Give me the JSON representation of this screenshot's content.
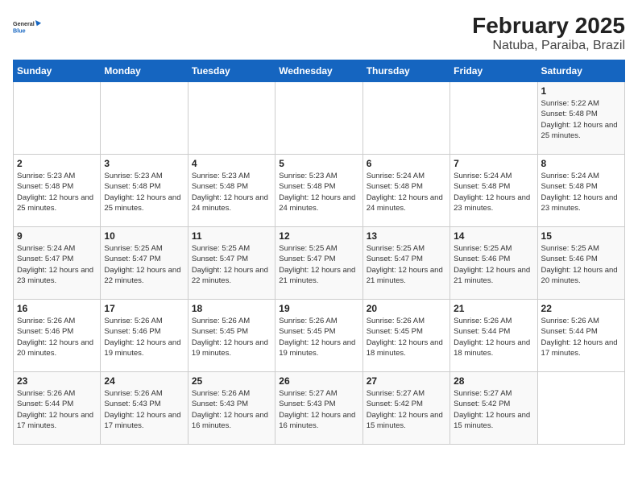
{
  "logo": {
    "text_general": "General",
    "text_blue": "Blue"
  },
  "title": "February 2025",
  "subtitle": "Natuba, Paraiba, Brazil",
  "days_of_week": [
    "Sunday",
    "Monday",
    "Tuesday",
    "Wednesday",
    "Thursday",
    "Friday",
    "Saturday"
  ],
  "weeks": [
    [
      {
        "day": "",
        "info": ""
      },
      {
        "day": "",
        "info": ""
      },
      {
        "day": "",
        "info": ""
      },
      {
        "day": "",
        "info": ""
      },
      {
        "day": "",
        "info": ""
      },
      {
        "day": "",
        "info": ""
      },
      {
        "day": "1",
        "info": "Sunrise: 5:22 AM\nSunset: 5:48 PM\nDaylight: 12 hours and 25 minutes."
      }
    ],
    [
      {
        "day": "2",
        "info": "Sunrise: 5:23 AM\nSunset: 5:48 PM\nDaylight: 12 hours and 25 minutes."
      },
      {
        "day": "3",
        "info": "Sunrise: 5:23 AM\nSunset: 5:48 PM\nDaylight: 12 hours and 25 minutes."
      },
      {
        "day": "4",
        "info": "Sunrise: 5:23 AM\nSunset: 5:48 PM\nDaylight: 12 hours and 24 minutes."
      },
      {
        "day": "5",
        "info": "Sunrise: 5:23 AM\nSunset: 5:48 PM\nDaylight: 12 hours and 24 minutes."
      },
      {
        "day": "6",
        "info": "Sunrise: 5:24 AM\nSunset: 5:48 PM\nDaylight: 12 hours and 24 minutes."
      },
      {
        "day": "7",
        "info": "Sunrise: 5:24 AM\nSunset: 5:48 PM\nDaylight: 12 hours and 23 minutes."
      },
      {
        "day": "8",
        "info": "Sunrise: 5:24 AM\nSunset: 5:48 PM\nDaylight: 12 hours and 23 minutes."
      }
    ],
    [
      {
        "day": "9",
        "info": "Sunrise: 5:24 AM\nSunset: 5:47 PM\nDaylight: 12 hours and 23 minutes."
      },
      {
        "day": "10",
        "info": "Sunrise: 5:25 AM\nSunset: 5:47 PM\nDaylight: 12 hours and 22 minutes."
      },
      {
        "day": "11",
        "info": "Sunrise: 5:25 AM\nSunset: 5:47 PM\nDaylight: 12 hours and 22 minutes."
      },
      {
        "day": "12",
        "info": "Sunrise: 5:25 AM\nSunset: 5:47 PM\nDaylight: 12 hours and 21 minutes."
      },
      {
        "day": "13",
        "info": "Sunrise: 5:25 AM\nSunset: 5:47 PM\nDaylight: 12 hours and 21 minutes."
      },
      {
        "day": "14",
        "info": "Sunrise: 5:25 AM\nSunset: 5:46 PM\nDaylight: 12 hours and 21 minutes."
      },
      {
        "day": "15",
        "info": "Sunrise: 5:25 AM\nSunset: 5:46 PM\nDaylight: 12 hours and 20 minutes."
      }
    ],
    [
      {
        "day": "16",
        "info": "Sunrise: 5:26 AM\nSunset: 5:46 PM\nDaylight: 12 hours and 20 minutes."
      },
      {
        "day": "17",
        "info": "Sunrise: 5:26 AM\nSunset: 5:46 PM\nDaylight: 12 hours and 19 minutes."
      },
      {
        "day": "18",
        "info": "Sunrise: 5:26 AM\nSunset: 5:45 PM\nDaylight: 12 hours and 19 minutes."
      },
      {
        "day": "19",
        "info": "Sunrise: 5:26 AM\nSunset: 5:45 PM\nDaylight: 12 hours and 19 minutes."
      },
      {
        "day": "20",
        "info": "Sunrise: 5:26 AM\nSunset: 5:45 PM\nDaylight: 12 hours and 18 minutes."
      },
      {
        "day": "21",
        "info": "Sunrise: 5:26 AM\nSunset: 5:44 PM\nDaylight: 12 hours and 18 minutes."
      },
      {
        "day": "22",
        "info": "Sunrise: 5:26 AM\nSunset: 5:44 PM\nDaylight: 12 hours and 17 minutes."
      }
    ],
    [
      {
        "day": "23",
        "info": "Sunrise: 5:26 AM\nSunset: 5:44 PM\nDaylight: 12 hours and 17 minutes."
      },
      {
        "day": "24",
        "info": "Sunrise: 5:26 AM\nSunset: 5:43 PM\nDaylight: 12 hours and 17 minutes."
      },
      {
        "day": "25",
        "info": "Sunrise: 5:26 AM\nSunset: 5:43 PM\nDaylight: 12 hours and 16 minutes."
      },
      {
        "day": "26",
        "info": "Sunrise: 5:27 AM\nSunset: 5:43 PM\nDaylight: 12 hours and 16 minutes."
      },
      {
        "day": "27",
        "info": "Sunrise: 5:27 AM\nSunset: 5:42 PM\nDaylight: 12 hours and 15 minutes."
      },
      {
        "day": "28",
        "info": "Sunrise: 5:27 AM\nSunset: 5:42 PM\nDaylight: 12 hours and 15 minutes."
      },
      {
        "day": "",
        "info": ""
      }
    ]
  ]
}
